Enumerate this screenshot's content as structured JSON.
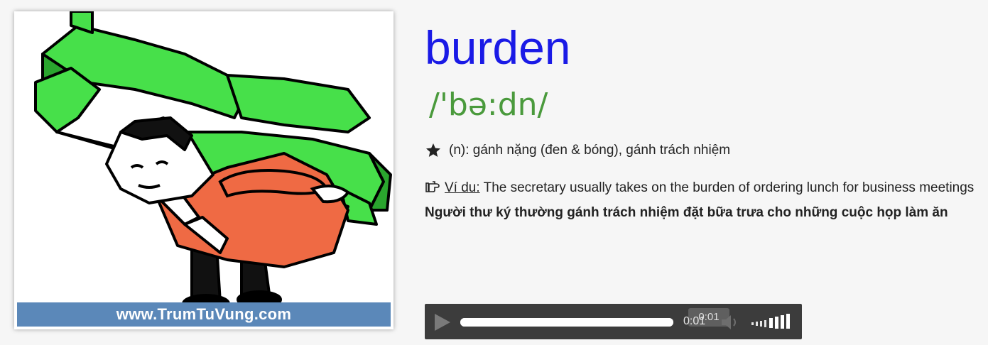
{
  "illustration": {
    "site_url": "www.TrumTuVung.com",
    "colors": {
      "dollar_green": "#47e04a",
      "shirt_orange": "#ef6a44",
      "banner_blue": "#5b88b9"
    }
  },
  "entry": {
    "word": "burden",
    "phonetic": "/'bə:dn/",
    "meaning": "(n): gánh nặng (đen & bóng), gánh trách nhiệm",
    "example_label": "Ví du:",
    "example_text": " The secretary usually takes on the burden of ordering lunch for business meetings",
    "translation": "Người thư ký thường gánh trách nhiệm đặt bữa trưa cho những cuộc họp làm ăn",
    "icons": {
      "meaning": "star-icon",
      "example": "pointing-hand-icon"
    },
    "colors": {
      "word": "#1a1ae6",
      "phonetic": "#4a9a3c"
    }
  },
  "audio": {
    "tooltip_time": "0:01",
    "current_time": "0:01",
    "progress_percent": 100,
    "icons": {
      "play": "play-icon",
      "volume": "speaker-icon",
      "volume_level": "volume-bars-icon"
    }
  }
}
